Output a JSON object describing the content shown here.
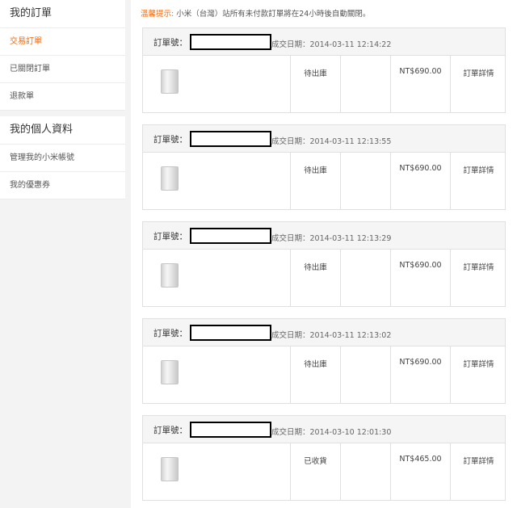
{
  "sidebar": {
    "orders": {
      "title": "我的訂單",
      "items": [
        {
          "label": "交易訂單",
          "active": true
        },
        {
          "label": "已關閉訂單",
          "active": false
        },
        {
          "label": "退款單",
          "active": false
        }
      ]
    },
    "profile": {
      "title": "我的個人資料",
      "items": [
        {
          "label": "管理我的小米帳號"
        },
        {
          "label": "我的優惠券"
        }
      ]
    }
  },
  "notice": {
    "label": "溫馨提示:",
    "text": "小米（台灣）站所有未付款訂單將在24小時後自動關閉。"
  },
  "orders": [
    {
      "order_label": "訂單號：",
      "date": "成交日期：2014-03-11 12:14:22",
      "status": "待出庫",
      "price": "NT$690.00",
      "detail": "訂單詳情"
    },
    {
      "order_label": "訂單號：",
      "date": "成交日期：2014-03-11 12:13:55",
      "status": "待出庫",
      "price": "NT$690.00",
      "detail": "訂單詳情"
    },
    {
      "order_label": "訂單號：",
      "date": "成交日期：2014-03-11 12:13:29",
      "status": "待出庫",
      "price": "NT$690.00",
      "detail": "訂單詳情"
    },
    {
      "order_label": "訂單號：",
      "date": "成交日期：2014-03-11 12:13:02",
      "status": "待出庫",
      "price": "NT$690.00",
      "detail": "訂單詳情"
    },
    {
      "order_label": "訂單號：",
      "date": "成交日期：2014-03-10 12:01:30",
      "status": "已收貨",
      "price": "NT$465.00",
      "detail": "訂單詳情"
    }
  ],
  "colors": {
    "accent": "#ff6700"
  }
}
